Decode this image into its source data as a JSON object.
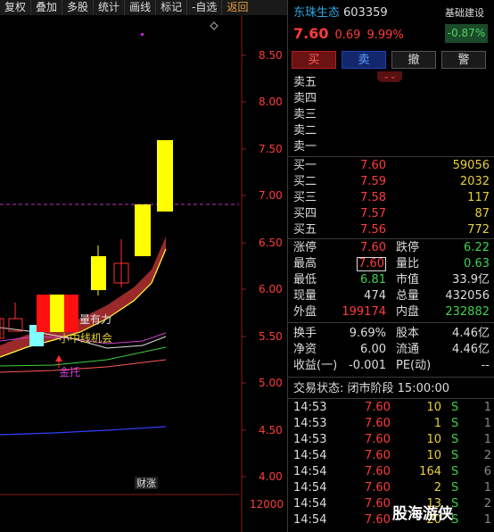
{
  "menu": [
    "复权",
    "叠加",
    "多股",
    "统计",
    "画线",
    "标记",
    "-自选",
    "返回"
  ],
  "chart": {
    "y_ticks": [
      "8.50",
      "8.00",
      "7.50",
      "7.00",
      "6.50",
      "6.00",
      "5.50",
      "5.00",
      "4.50",
      "4.00"
    ],
    "vol_tick": "12000",
    "labels": {
      "strength": "量有力",
      "midline": "小中线机会",
      "support": "金托",
      "finance": "财涨"
    },
    "colors": {
      "up": "#ff2020",
      "limit_up": "#ffff00",
      "down": "#7fffff",
      "band": "#9a2a2a",
      "dashed": "#c030c0"
    }
  },
  "header": {
    "name": "东珠生态",
    "code": "603359",
    "settings": "基础建设",
    "sector_pct": "-0.87%",
    "price": "7.60",
    "change": "0.69",
    "pct": "9.99%"
  },
  "buttons": [
    "买",
    "卖",
    "撤",
    "警"
  ],
  "ask": [
    {
      "label": "卖五"
    },
    {
      "label": "卖四"
    },
    {
      "label": "卖三"
    },
    {
      "label": "卖二"
    },
    {
      "label": "卖一"
    }
  ],
  "bid": [
    {
      "label": "买一",
      "price": "7.60",
      "vol": "59056"
    },
    {
      "label": "买二",
      "price": "7.59",
      "vol": "2032"
    },
    {
      "label": "买三",
      "price": "7.58",
      "vol": "117"
    },
    {
      "label": "买四",
      "price": "7.57",
      "vol": "87"
    },
    {
      "label": "买五",
      "price": "7.56",
      "vol": "772"
    }
  ],
  "stats": {
    "zhangting_l": "涨停",
    "zhangting": "7.60",
    "dieting_l": "跌停",
    "dieting": "6.22",
    "high_l": "最高",
    "high": "7.60",
    "liangbi_l": "量比",
    "liangbi": "0.63",
    "low_l": "最低",
    "low": "6.81",
    "shizhi_l": "市值",
    "shizhi": "33.9亿",
    "xianliang_l": "现量",
    "xianliang": "474",
    "zongliang_l": "总量",
    "zongliang": "432056",
    "waipan_l": "外盘",
    "waipan": "199174",
    "neipan_l": "内盘",
    "neipan": "232882",
    "huanshou_l": "换手",
    "huanshou": "9.69%",
    "guben_l": "股本",
    "guben": "4.46亿",
    "jingzi_l": "净资",
    "jingzi": "6.00",
    "liutong_l": "流通",
    "liutong": "4.46亿",
    "shouyi_l": "收益(一)",
    "shouyi": "-0.001",
    "pe_l": "PE(动)",
    "pe": "--"
  },
  "status": "交易状态: 闭市阶段 15:00:00",
  "ticks": [
    {
      "time": "14:53",
      "price": "7.60",
      "vol": "10",
      "flag": "S",
      "n": "1"
    },
    {
      "time": "14:53",
      "price": "7.60",
      "vol": "1",
      "flag": "S",
      "n": "1"
    },
    {
      "time": "14:53",
      "price": "7.60",
      "vol": "10",
      "flag": "S",
      "n": "1"
    },
    {
      "time": "14:54",
      "price": "7.60",
      "vol": "10",
      "flag": "S",
      "n": "2"
    },
    {
      "time": "14:54",
      "price": "7.60",
      "vol": "164",
      "flag": "S",
      "n": "6"
    },
    {
      "time": "14:54",
      "price": "7.60",
      "vol": "2",
      "flag": "S",
      "n": "1"
    },
    {
      "time": "14:54",
      "price": "7.60",
      "vol": "13",
      "flag": "S",
      "n": "2"
    },
    {
      "time": "14:54",
      "price": "7.60",
      "vol": "20",
      "flag": "S",
      "n": "1"
    }
  ],
  "watermark": "股海游侠"
}
